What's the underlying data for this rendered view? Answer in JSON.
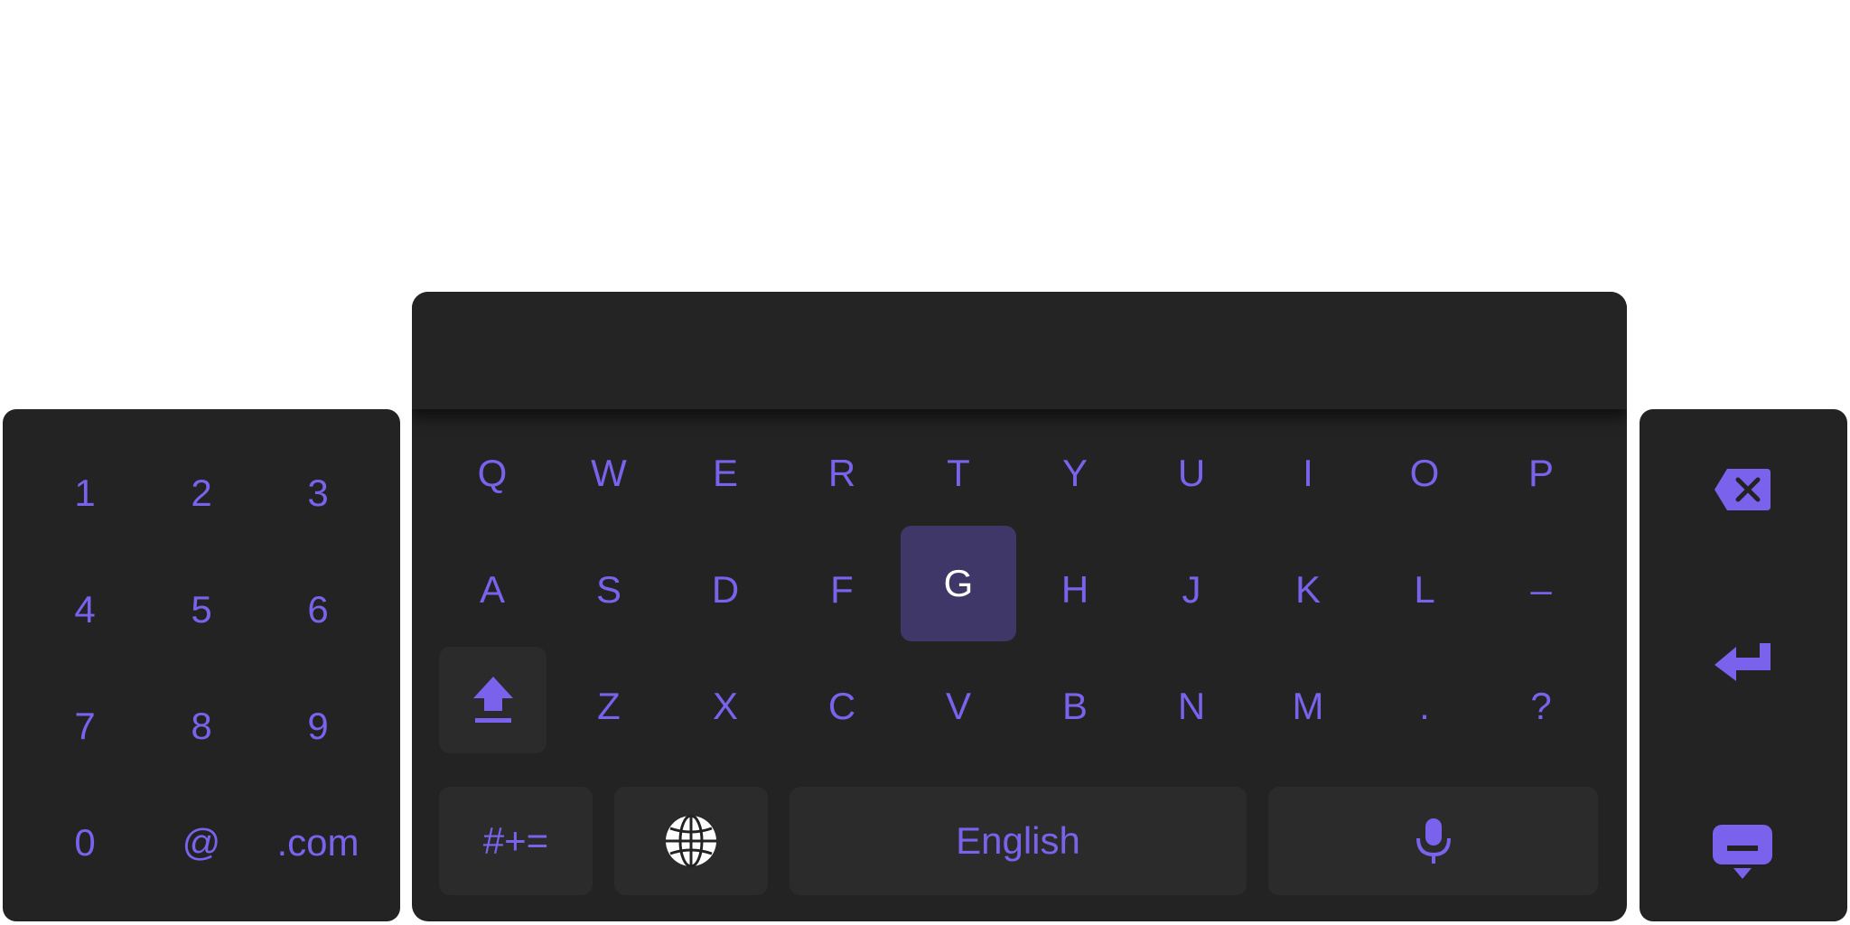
{
  "numpad": {
    "keys": [
      "1",
      "2",
      "3",
      "4",
      "5",
      "6",
      "7",
      "8",
      "9",
      "0",
      "@",
      ".com"
    ]
  },
  "keyboard": {
    "row1": [
      "Q",
      "W",
      "E",
      "R",
      "T",
      "Y",
      "U",
      "I",
      "O",
      "P"
    ],
    "row2": [
      "A",
      "S",
      "D",
      "F",
      "G",
      "H",
      "J",
      "K",
      "L",
      "–"
    ],
    "row3": [
      "Z",
      "X",
      "C",
      "V",
      "B",
      "N",
      "M",
      ".",
      "?"
    ],
    "active_key": "G",
    "symbols_label": "#+=",
    "space_label": "English",
    "icons": {
      "shift": "shift-arrow-icon",
      "language": "globe-icon",
      "voice": "microphone-icon"
    }
  },
  "actions": {
    "icons": [
      "backspace-icon",
      "enter-icon",
      "hide-keyboard-icon"
    ]
  },
  "colors": {
    "panel_bg": "#232323",
    "accent": "#7a62ec",
    "active_key_bg": "#3f3768",
    "active_key_text": "#ffffff",
    "button_bg": "#2b2b2b"
  }
}
